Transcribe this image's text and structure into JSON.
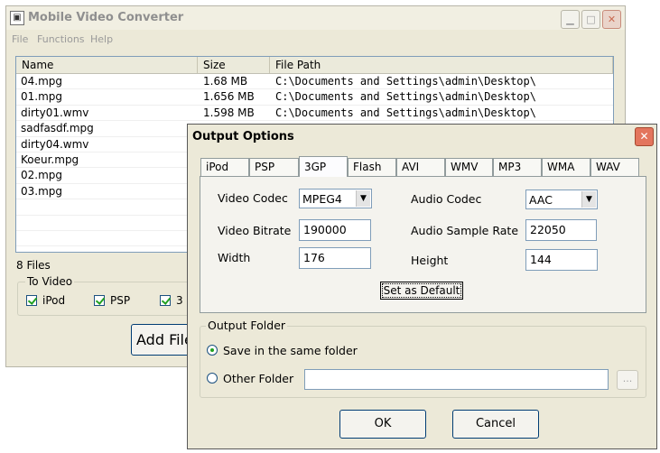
{
  "main_window": {
    "title": "Mobile Video Converter",
    "menu": [
      "File",
      "Functions",
      "Help"
    ],
    "list_columns": [
      "Name",
      "Size",
      "File Path"
    ],
    "files": [
      {
        "name": "04.mpg",
        "size": "1.68 MB",
        "path": "C:\\Documents and Settings\\admin\\Desktop\\"
      },
      {
        "name": "01.mpg",
        "size": "1.656 MB",
        "path": "C:\\Documents and Settings\\admin\\Desktop\\"
      },
      {
        "name": "dirty01.wmv",
        "size": "1.598 MB",
        "path": "C:\\Documents and Settings\\admin\\Desktop\\"
      },
      {
        "name": "sadfasdf.mpg",
        "size": "",
        "path": ""
      },
      {
        "name": "dirty04.wmv",
        "size": "",
        "path": ""
      },
      {
        "name": "Koeur.mpg",
        "size": "",
        "path": ""
      },
      {
        "name": "02.mpg",
        "size": "",
        "path": ""
      },
      {
        "name": "03.mpg",
        "size": "",
        "path": ""
      },
      {
        "name": "",
        "size": "",
        "path": ""
      },
      {
        "name": "",
        "size": "",
        "path": ""
      },
      {
        "name": "",
        "size": "",
        "path": ""
      }
    ],
    "files_count": "8 Files",
    "to_video_label": "To Video",
    "to_video_options": [
      {
        "label": "iPod",
        "checked": true
      },
      {
        "label": "PSP",
        "checked": true
      },
      {
        "label": "3",
        "checked": true
      }
    ],
    "add_files_label": "Add File"
  },
  "dialog": {
    "title": "Output Options",
    "tabs": [
      "iPod",
      "PSP",
      "3GP",
      "Flash",
      "AVI",
      "WMV",
      "MP3",
      "WMA",
      "WAV"
    ],
    "active_tab": "3GP",
    "video_codec_label": "Video Codec",
    "video_codec_value": "MPEG4",
    "video_bitrate_label": "Video Bitrate",
    "video_bitrate_value": "190000",
    "width_label": "Width",
    "width_value": "176",
    "audio_codec_label": "Audio Codec",
    "audio_codec_value": "AAC",
    "audio_sample_rate_label": "Audio Sample Rate",
    "audio_sample_rate_value": "22050",
    "height_label": "Height",
    "height_value": "144",
    "set_default_label": "Set as Default",
    "output_folder_label": "Output Folder",
    "same_folder_label": "Save in the same folder",
    "other_folder_label": "Other Folder",
    "other_folder_value": "",
    "browse_label": "...",
    "ok_label": "OK",
    "cancel_label": "Cancel"
  }
}
